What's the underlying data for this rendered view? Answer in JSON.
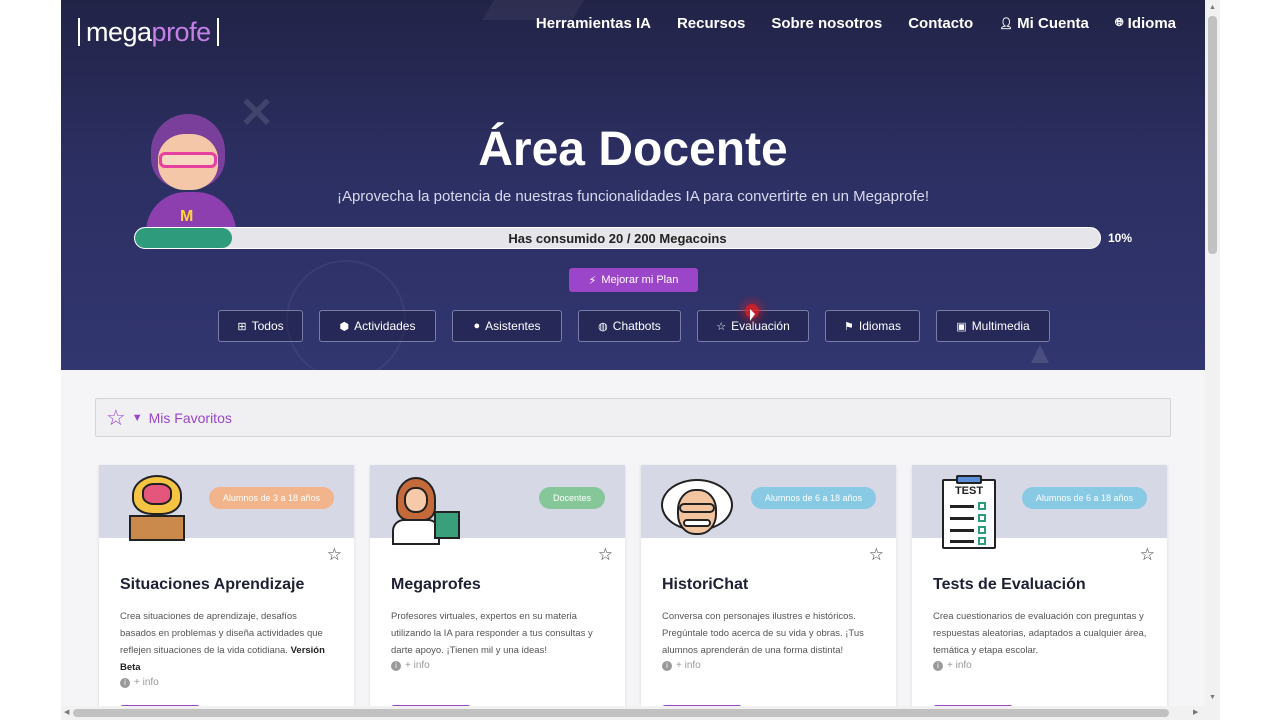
{
  "logo": {
    "part1": "mega",
    "part2": "profe"
  },
  "nav": [
    {
      "label": "Herramientas IA",
      "icon": ""
    },
    {
      "label": "Recursos",
      "icon": ""
    },
    {
      "label": "Sobre nosotros",
      "icon": ""
    },
    {
      "label": "Contacto",
      "icon": ""
    },
    {
      "label": "Mi Cuenta",
      "icon": "user-icon"
    },
    {
      "label": "Idioma",
      "icon": "globe-icon"
    }
  ],
  "hero": {
    "title": "Área Docente",
    "subtitle": "¡Aprovecha la potencia de nuestras funcionalidades IA para convertirte en un Megaprofe!"
  },
  "usage": {
    "text": "Has consumido 20 / 200 Megacoins",
    "percent_label": "10%",
    "fraction": 0.1
  },
  "upgrade_button": "Mejorar mi Plan",
  "filters": [
    {
      "label": "Todos",
      "icon": "grid-icon"
    },
    {
      "label": "Actividades",
      "icon": "cube-icon"
    },
    {
      "label": "Asistentes",
      "icon": "chat-bubble-icon"
    },
    {
      "label": "Chatbots",
      "icon": "robot-icon"
    },
    {
      "label": "Evaluación",
      "icon": "star-icon"
    },
    {
      "label": "Idiomas",
      "icon": "flag-icon"
    },
    {
      "label": "Multimedia",
      "icon": "image-icon"
    }
  ],
  "favorites": {
    "label": "Mis Favoritos"
  },
  "cards": [
    {
      "title": "Situaciones Aprendizaje",
      "badge": "Alumnos de 3 a 18 años",
      "badge_color": "#f2b48a",
      "desc": "Crea situaciones de aprendizaje, desafíos basados en problemas y diseña actividades que reflejen situaciones de la vida cotidiana.",
      "desc_bold": "Versión Beta",
      "info": "+ info"
    },
    {
      "title": "Megaprofes",
      "badge": "Docentes",
      "badge_color": "#86c79a",
      "desc": "Profesores virtuales, expertos en su materia utilizando la IA para responder a tus consultas y darte apoyo. ¡Tienen mil y una ideas!",
      "desc_bold": "",
      "info": "+ info"
    },
    {
      "title": "HistoriChat",
      "badge": "Alumnos de 6 a 18 años",
      "badge_color": "#88c9e3",
      "desc": "Conversa con personajes ilustres e históricos. Pregúntale todo acerca de su vida y obras. ¡Tus alumnos aprenderán de una forma distinta!",
      "desc_bold": "",
      "info": "+ info"
    },
    {
      "title": "Tests de Evaluación",
      "badge": "Alumnos de 6 a 18 años",
      "badge_color": "#88c9e3",
      "desc": "Crea cuestionarios de evaluación con preguntas y respuestas aleatorias, adaptados a cualquier área, temática y etapa escolar.",
      "desc_bold": "",
      "info": "+ info"
    }
  ],
  "test_icon_label": "TEST",
  "colors": {
    "accent": "#9b46c9",
    "progress": "#2e9b7d",
    "hero": "#2c2f62"
  }
}
